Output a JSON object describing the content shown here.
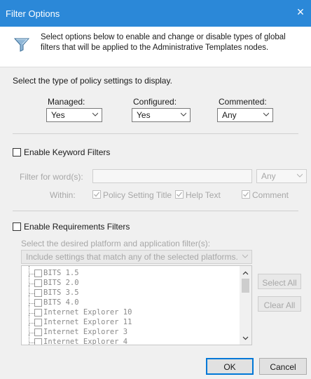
{
  "window": {
    "title": "Filter Options",
    "close_glyph": "×"
  },
  "header": {
    "icon": "funnel-icon",
    "description": "Select options below to enable and change or disable types of global filters that will be applied to the Administrative Templates nodes."
  },
  "policy_type": {
    "label": "Select the type of policy settings to display.",
    "managed": {
      "label": "Managed:",
      "value": "Yes"
    },
    "configured": {
      "label": "Configured:",
      "value": "Yes"
    },
    "commented": {
      "label": "Commented:",
      "value": "Any"
    }
  },
  "keyword_filters": {
    "enable_label": "Enable Keyword Filters",
    "filter_label": "Filter for word(s):",
    "filter_value": "",
    "match_value": "Any",
    "within_label": "Within:",
    "options": [
      "Policy Setting Title",
      "Help Text",
      "Comment"
    ]
  },
  "requirements_filters": {
    "enable_label": "Enable Requirements Filters",
    "select_label": "Select the desired platform and application filter(s):",
    "match_value": "Include settings that match any of the selected platforms.",
    "platforms": [
      "BITS 1.5",
      "BITS 2.0",
      "BITS 3.5",
      "BITS 4.0",
      "Internet Explorer 10",
      "Internet Explorer 11",
      "Internet Explorer 3",
      "Internet Explorer 4"
    ],
    "select_all_label": "Select All",
    "clear_all_label": "Clear All"
  },
  "footer": {
    "ok_label": "OK",
    "cancel_label": "Cancel"
  },
  "colors": {
    "titlebar": "#2b88d8",
    "accent": "#0078d7",
    "dialog_bg": "#f0f0f0"
  }
}
